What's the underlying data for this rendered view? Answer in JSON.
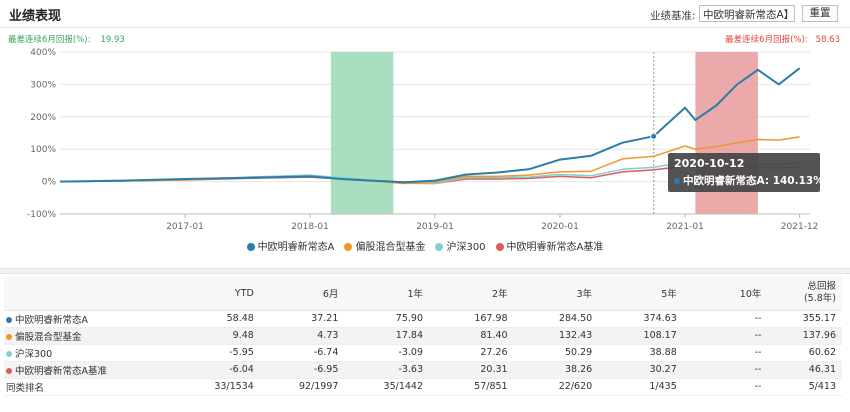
{
  "header": {
    "title": "业绩表现",
    "benchmark_label": "业绩基准:",
    "benchmark_value": "中欧明睿新常态A】",
    "reset_label": "重置"
  },
  "drawdown": {
    "left_label": "最差连续6月回报(%):",
    "left_value": "19.93",
    "right_label": "最差连续6月回报(%):",
    "right_value": "58.63",
    "left_color": "#3aa55c",
    "right_color": "#e2463b"
  },
  "tooltip": {
    "date": "2020-10-12",
    "label": "中欧明睿新常态A:",
    "value": "140.13%"
  },
  "legend": [
    {
      "name": "中欧明睿新常态A",
      "color": "#2b7ea8"
    },
    {
      "name": "偏股混合型基金",
      "color": "#f0962a"
    },
    {
      "name": "沪深300",
      "color": "#7fd0cf"
    },
    {
      "name": "中欧明睿新常态A基准",
      "color": "#e0595b"
    }
  ],
  "chart_data": {
    "type": "line",
    "x_ticks": [
      "2017-01",
      "2018-01",
      "2019-01",
      "2020-01",
      "2021-01",
      "2021-12"
    ],
    "y_ticks": [
      "400%",
      "300%",
      "200%",
      "100%",
      "0%",
      "-100%"
    ],
    "ylim": [
      -100,
      400
    ],
    "shaded_regions": [
      {
        "label": "最差连续6月回报",
        "start": "2018-03",
        "end": "2018-09",
        "color": "#9bd8b5"
      },
      {
        "label": "最差连续6月回报",
        "start": "2021-02",
        "end": "2021-08",
        "color": "#e99a9a"
      }
    ],
    "series": [
      {
        "name": "中欧明睿新常态A",
        "color": "#2b7ea8",
        "x": [
          "2016-01",
          "2016-07",
          "2017-01",
          "2017-07",
          "2018-01",
          "2018-04",
          "2018-07",
          "2018-10",
          "2019-01",
          "2019-04",
          "2019-07",
          "2019-10",
          "2020-01",
          "2020-04",
          "2020-07",
          "2020-10",
          "2021-01",
          "2021-02",
          "2021-04",
          "2021-06",
          "2021-08",
          "2021-10",
          "2021-12"
        ],
        "values": [
          0,
          3,
          8,
          12,
          16,
          8,
          3,
          -2,
          3,
          22,
          28,
          38,
          68,
          80,
          120,
          140,
          228,
          190,
          235,
          300,
          345,
          300,
          350
        ]
      },
      {
        "name": "偏股混合型基金",
        "color": "#f0962a",
        "x": [
          "2016-01",
          "2016-07",
          "2017-01",
          "2017-07",
          "2018-01",
          "2018-04",
          "2018-07",
          "2018-10",
          "2019-01",
          "2019-04",
          "2019-07",
          "2019-10",
          "2020-01",
          "2020-04",
          "2020-07",
          "2020-10",
          "2021-01",
          "2021-02",
          "2021-04",
          "2021-06",
          "2021-08",
          "2021-10",
          "2021-12"
        ],
        "values": [
          0,
          2,
          6,
          12,
          16,
          8,
          2,
          -6,
          -2,
          16,
          16,
          20,
          30,
          32,
          70,
          78,
          110,
          100,
          108,
          120,
          130,
          128,
          138
        ]
      },
      {
        "name": "沪深300",
        "color": "#7fd0cf",
        "x": [
          "2016-01",
          "2016-07",
          "2017-01",
          "2017-07",
          "2018-01",
          "2018-04",
          "2018-07",
          "2018-10",
          "2019-01",
          "2019-04",
          "2019-07",
          "2019-10",
          "2020-01",
          "2020-04",
          "2020-07",
          "2020-10",
          "2021-01",
          "2021-02",
          "2021-04",
          "2021-06",
          "2021-08",
          "2021-10",
          "2021-12"
        ],
        "values": [
          0,
          2,
          6,
          14,
          20,
          12,
          4,
          -4,
          -6,
          12,
          12,
          14,
          22,
          18,
          38,
          44,
          60,
          55,
          55,
          58,
          54,
          52,
          60
        ]
      },
      {
        "name": "中欧明睿新常态A基准",
        "color": "#e0595b",
        "x": [
          "2016-01",
          "2016-07",
          "2017-01",
          "2017-07",
          "2018-01",
          "2018-04",
          "2018-07",
          "2018-10",
          "2019-01",
          "2019-04",
          "2019-07",
          "2019-10",
          "2020-01",
          "2020-04",
          "2020-07",
          "2020-10",
          "2021-01",
          "2021-02",
          "2021-04",
          "2021-06",
          "2021-08",
          "2021-10",
          "2021-12"
        ],
        "values": [
          0,
          2,
          5,
          10,
          14,
          8,
          2,
          -5,
          -6,
          8,
          8,
          10,
          16,
          12,
          30,
          36,
          48,
          44,
          44,
          46,
          44,
          42,
          46
        ]
      }
    ]
  },
  "table": {
    "columns": [
      "",
      "YTD",
      "6月",
      "1年",
      "2年",
      "3年",
      "5年",
      "10年",
      "总回报\n(5.8年)"
    ],
    "rows": [
      {
        "name": "中欧明睿新常态A",
        "color": "#2b7ea8",
        "values": [
          "58.48",
          "37.21",
          "75.90",
          "167.98",
          "284.50",
          "374.63",
          "--",
          "355.17"
        ]
      },
      {
        "name": "偏股混合型基金",
        "color": "#f0962a",
        "values": [
          "9.48",
          "4.73",
          "17.84",
          "81.40",
          "132.43",
          "108.17",
          "--",
          "137.96"
        ]
      },
      {
        "name": "沪深300",
        "color": "#7fd0cf",
        "values": [
          "-5.95",
          "-6.74",
          "-3.09",
          "27.26",
          "50.29",
          "38.88",
          "--",
          "60.62"
        ]
      },
      {
        "name": "中欧明睿新常态A基准",
        "color": "#e0595b",
        "values": [
          "-6.04",
          "-6.95",
          "-3.63",
          "20.31",
          "38.26",
          "30.27",
          "--",
          "46.31"
        ]
      },
      {
        "name": "同类排名",
        "color": "",
        "values": [
          "33/1534",
          "92/1997",
          "35/1442",
          "57/851",
          "22/620",
          "1/435",
          "--",
          "5/413"
        ]
      }
    ]
  }
}
